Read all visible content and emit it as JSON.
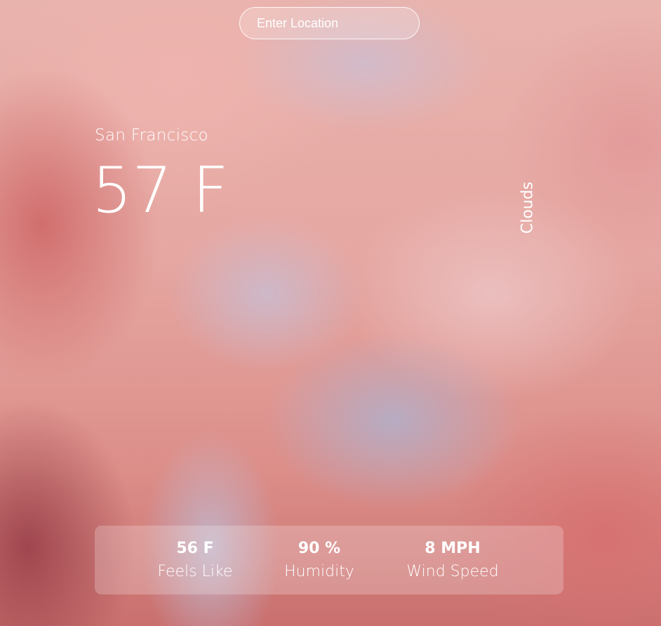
{
  "search": {
    "placeholder": "Enter Location"
  },
  "weather": {
    "location": "San Francisco",
    "temperature": "57 F",
    "condition": "Clouds"
  },
  "stats": {
    "feels_like": {
      "value": "56 F",
      "label": "Feels Like"
    },
    "humidity": {
      "value": "90 %",
      "label": "Humidity"
    },
    "wind_speed": {
      "value": "8 MPH",
      "label": "Wind Speed"
    }
  },
  "colors": {
    "text": "#ffffff",
    "panel": "rgba(255,255,255,0.22)"
  }
}
